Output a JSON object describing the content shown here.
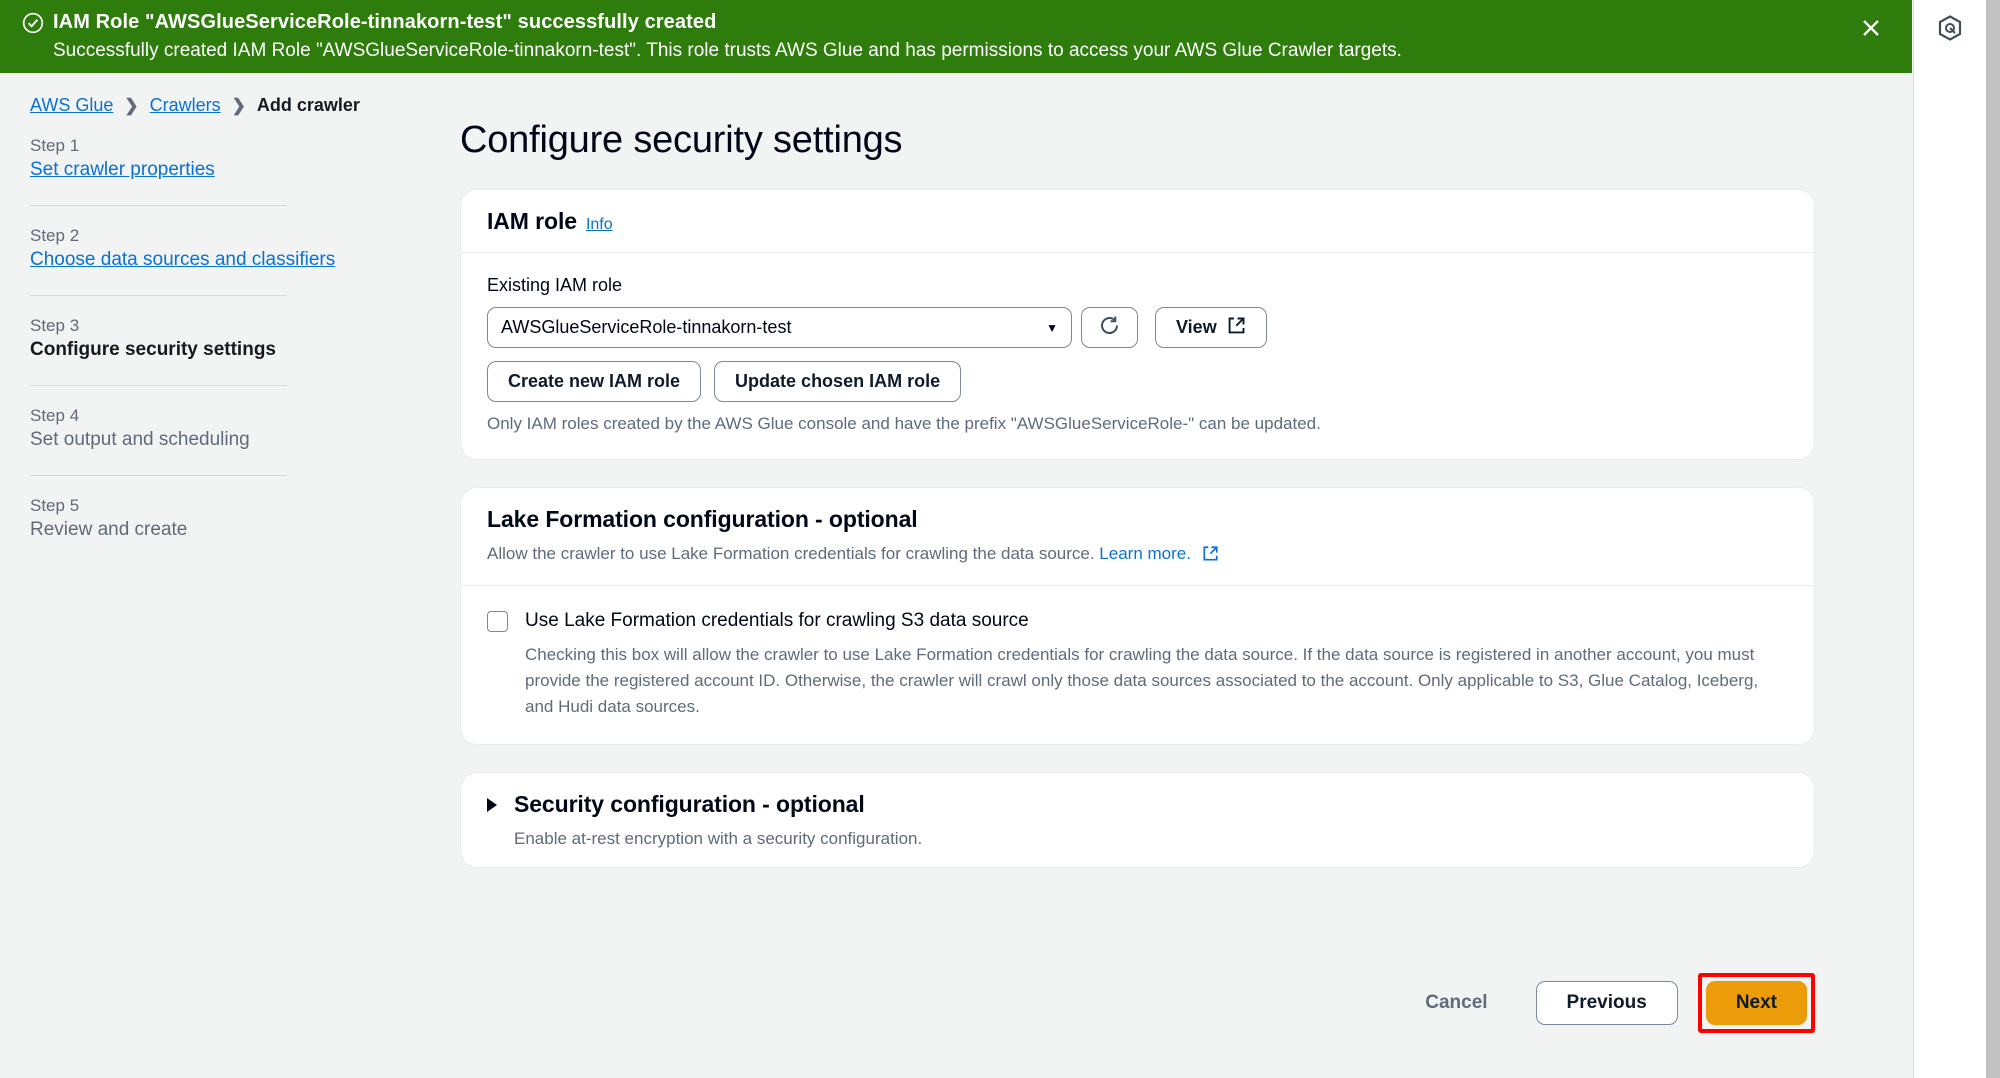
{
  "flash": {
    "icon": "check-circle-icon",
    "title": "IAM Role \"AWSGlueServiceRole-tinnakorn-test\" successfully created",
    "message": "Successfully created IAM Role \"AWSGlueServiceRole-tinnakorn-test\". This role trusts AWS Glue and has permissions to access your AWS Glue Crawler targets.",
    "close_icon": "close-icon",
    "background": "#2e7d0c"
  },
  "right_rail": {
    "icon": "glue-service-hex-icon"
  },
  "breadcrumb": {
    "items": [
      {
        "label": "AWS Glue",
        "type": "link"
      },
      {
        "label": "Crawlers",
        "type": "link"
      },
      {
        "label": "Add crawler",
        "type": "current"
      }
    ],
    "separator": "›"
  },
  "steps": [
    {
      "num": "Step 1",
      "name": "Set crawler properties",
      "state": "link"
    },
    {
      "num": "Step 2",
      "name": "Choose data sources and classifiers",
      "state": "link"
    },
    {
      "num": "Step 3",
      "name": "Configure security settings",
      "state": "current"
    },
    {
      "num": "Step 4",
      "name": "Set output and scheduling",
      "state": "plain"
    },
    {
      "num": "Step 5",
      "name": "Review and create",
      "state": "plain"
    }
  ],
  "main": {
    "page_title": "Configure security settings",
    "iam": {
      "card_title": "IAM role",
      "info_label": "Info",
      "field_label": "Existing IAM role",
      "selected_role": "AWSGlueServiceRole-tinnakorn-test",
      "caret_icon": "chevron-down-icon",
      "refresh_icon": "refresh-icon",
      "view_label": "View",
      "external_icon": "external-link-icon",
      "create_role_label": "Create new IAM role",
      "update_role_label": "Update chosen IAM role",
      "hint": "Only IAM roles created by the AWS Glue console and have the prefix \"AWSGlueServiceRole-\" can be updated."
    },
    "lake_formation": {
      "card_title": "Lake Formation configuration - ",
      "card_title_optional": "optional",
      "description": "Allow the crawler to use Lake Formation credentials for crawling the data source. ",
      "learn_more": "Learn more.",
      "learn_more_icon": "external-link-icon",
      "checkbox_checked": false,
      "checkbox_label": "Use Lake Formation credentials for crawling S3 data source",
      "checkbox_description": "Checking this box will allow the crawler to use Lake Formation credentials for crawling the data source. If the data source is registered in another account, you must provide the registered account ID. Otherwise, the crawler will crawl only those data sources associated to the account. Only applicable to S3, Glue Catalog, Iceberg, and Hudi data sources."
    },
    "security_config": {
      "expanded": false,
      "expander_icon": "triangle-right-icon",
      "card_title": "Security configuration - ",
      "card_title_optional": "optional",
      "description": "Enable at-rest encryption with a security configuration."
    }
  },
  "footer": {
    "cancel_label": "Cancel",
    "previous_label": "Previous",
    "next_label": "Next",
    "next_accent": "#ec9c09",
    "highlight_color": "#ff0000"
  }
}
